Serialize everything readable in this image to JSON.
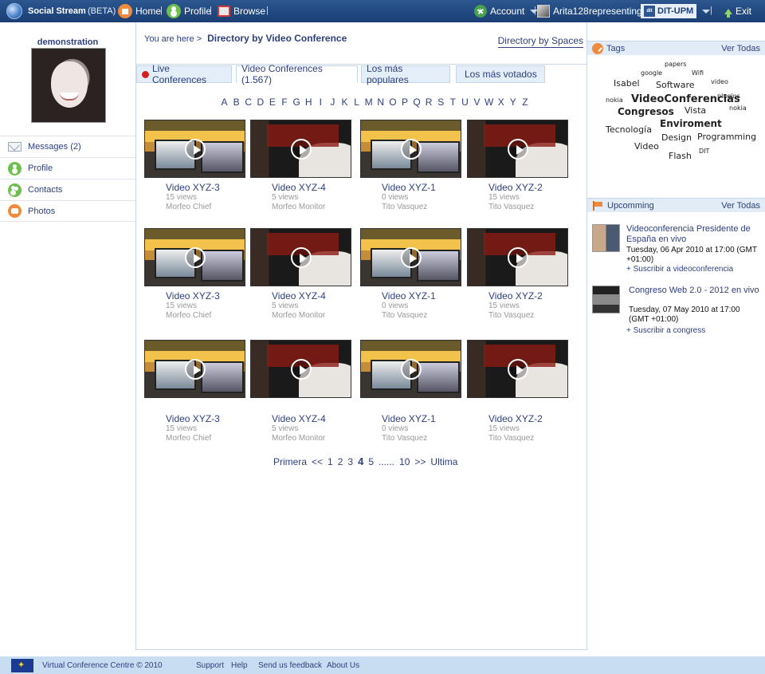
{
  "topbar": {
    "brand": "Social Stream",
    "beta": "(BETA)",
    "home": "Home",
    "profile": "Profile",
    "browse": "Browse",
    "sep": "|",
    "account": "Account",
    "user": "Arita128",
    "representing": "representing",
    "org": "DIT-UPM",
    "exit": "Exit"
  },
  "sidebar": {
    "username": "demonstration",
    "items": [
      {
        "label": "Messages (2)"
      },
      {
        "label": "Profile"
      },
      {
        "label": "Contacts"
      },
      {
        "label": "Photos"
      }
    ]
  },
  "main": {
    "crumb_prefix": "You are here >",
    "crumb_current": "Directory by Video Conference",
    "spaces_link": "Directory by Spaces",
    "tabs": [
      {
        "label": "Live Conferences"
      },
      {
        "label": "Video Conferences (1.567)"
      },
      {
        "label": "Los más populares"
      },
      {
        "label": "Los más votados"
      }
    ],
    "letters": [
      "A",
      "B",
      "C",
      "D",
      "E",
      "F",
      "G",
      "H",
      "I",
      "J",
      "K",
      "L",
      "M",
      "N",
      "O",
      "P",
      "Q",
      "R",
      "S",
      "T",
      "U",
      "V",
      "W",
      "X",
      "Y",
      "Z"
    ],
    "videos": [
      {
        "title": "Video XYZ-3",
        "views": "15 views",
        "owner": "Morfeo Chief"
      },
      {
        "title": "Video XYZ-4",
        "views": "5 views",
        "owner": "Morfeo Monitor"
      },
      {
        "title": "Video XYZ-1",
        "views": "0 views",
        "owner": "Tito Vasquez"
      },
      {
        "title": "Video XYZ-2",
        "views": "15 views",
        "owner": "Tito Vasquez"
      },
      {
        "title": "Video XYZ-3",
        "views": "15 views",
        "owner": "Morfeo Chief"
      },
      {
        "title": "Video XYZ-4",
        "views": "5 views",
        "owner": "Morfeo Monitor"
      },
      {
        "title": "Video XYZ-1",
        "views": "0 views",
        "owner": "Tito Vasquez"
      },
      {
        "title": "Video XYZ-2",
        "views": "15 views",
        "owner": "Tito Vasquez"
      },
      {
        "title": "Video XYZ-3",
        "views": "15 views",
        "owner": "Morfeo Chief"
      },
      {
        "title": "Video XYZ-4",
        "views": "5 views",
        "owner": "Morfeo Monitor"
      },
      {
        "title": "Video XYZ-1",
        "views": "0 views",
        "owner": "Tito Vasquez"
      },
      {
        "title": "Video XYZ-2",
        "views": "15 views",
        "owner": "Tito Vasquez"
      }
    ],
    "pager": {
      "first": "Primera",
      "prev": "<<",
      "pages": [
        "1",
        "2",
        "3"
      ],
      "current": "4",
      "next_page": "5",
      "ellipsis": "......",
      "last_num": "10",
      "next": ">>",
      "last": "Ultima"
    }
  },
  "right": {
    "tags_title": "Tags",
    "tags_viewall": "Ver Todas",
    "tags": [
      {
        "text": "papers",
        "size": 8
      },
      {
        "text": "google",
        "size": 8
      },
      {
        "text": "Wifi",
        "size": 8
      },
      {
        "text": "Isabel",
        "size": 11
      },
      {
        "text": "Software",
        "size": 11
      },
      {
        "text": "video",
        "size": 8
      },
      {
        "text": "nokia",
        "size": 8
      },
      {
        "text": "VideoConferencias",
        "size": 13
      },
      {
        "text": "plugins",
        "size": 8
      },
      {
        "text": "Congresos",
        "size": 12
      },
      {
        "text": "Vista",
        "size": 11
      },
      {
        "text": "nokia",
        "size": 8
      },
      {
        "text": "Enviroment",
        "size": 12
      },
      {
        "text": "Tecnología",
        "size": 11
      },
      {
        "text": "Design",
        "size": 11
      },
      {
        "text": "Programming",
        "size": 11
      },
      {
        "text": "Video",
        "size": 11
      },
      {
        "text": "DIT",
        "size": 8
      },
      {
        "text": "Flash",
        "size": 11
      }
    ],
    "upcoming_title": "Upcomming",
    "upcoming_viewall": "Ver Todas",
    "events": [
      {
        "title": "Videoconferencia Presidente de España en vivo",
        "date": "Tuesday, 06 Apr 2010 at 17:00 (GMT +01:00)",
        "subscribe": "+ Suscribir a videoconferencia"
      },
      {
        "title": "Congreso Web 2.0 - 2012 en vivo",
        "date": "Tuesday, 07 May 2010 at 17:00 (GMT +01:00)",
        "subscribe": "+ Suscribir a congress"
      }
    ]
  },
  "footer": {
    "copyright": "Virtual Conference Centre © 2010",
    "links": [
      "Support",
      "Help",
      "Send us feedback",
      "About Us"
    ]
  }
}
